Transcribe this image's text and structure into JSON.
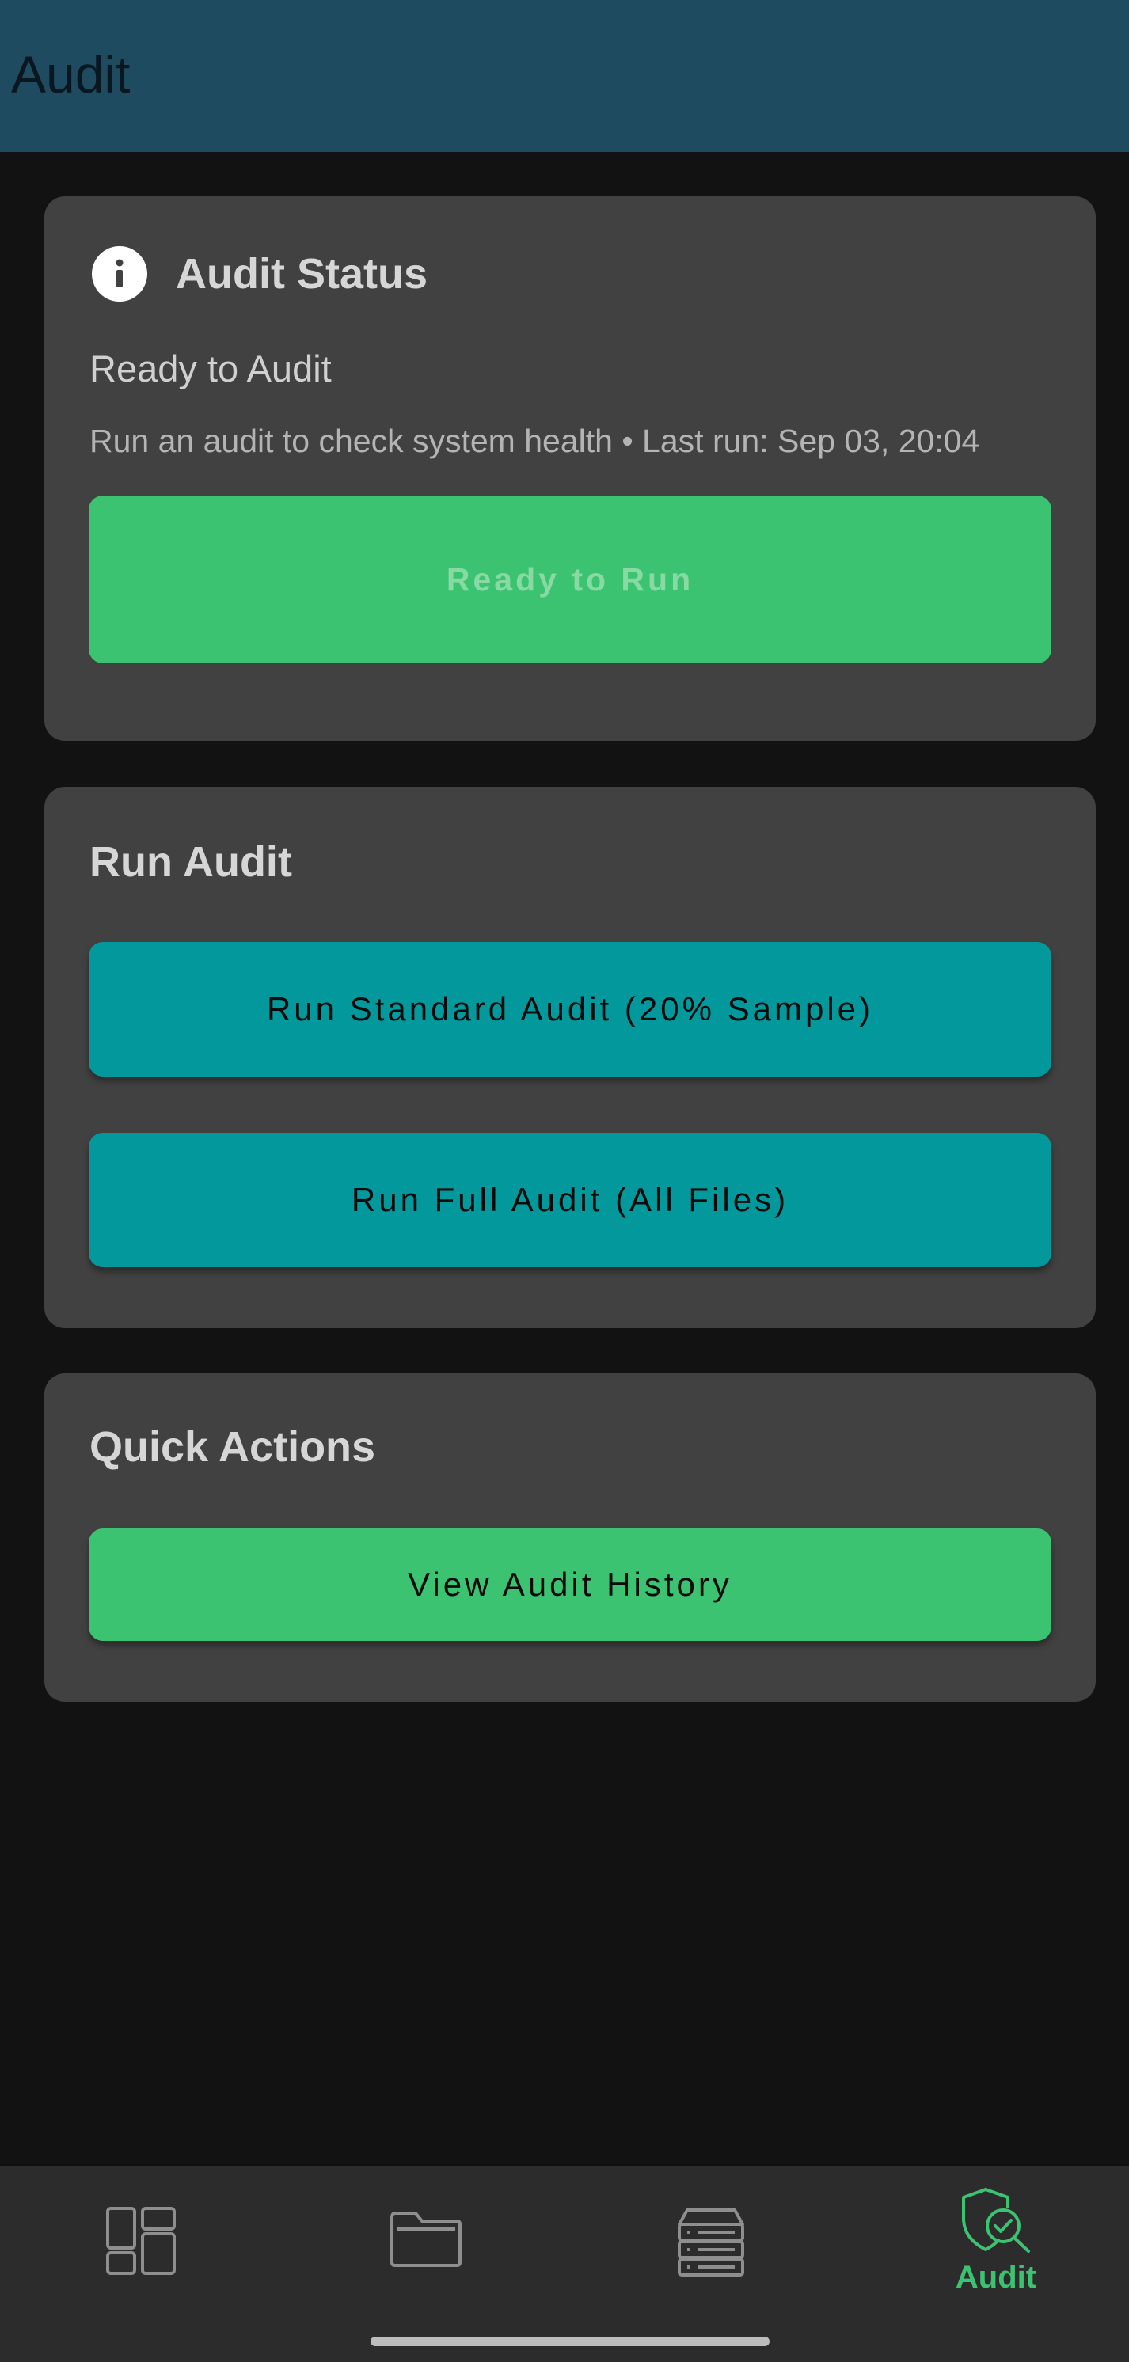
{
  "appbar": {
    "title": "Audit"
  },
  "status_card": {
    "icon": "info-icon",
    "title": "Audit Status",
    "subtitle": "Ready to Audit",
    "description": "Run an audit to check system health • Last run: Sep 03, 20:04",
    "button_label": "Ready to Run"
  },
  "run_card": {
    "title": "Run Audit",
    "standard_label": "Run Standard Audit (20% Sample)",
    "full_label": "Run Full Audit (All Files)"
  },
  "quick_card": {
    "title": "Quick Actions",
    "history_label": "View Audit History"
  },
  "bottom_nav": {
    "items": [
      {
        "icon": "dashboard-icon",
        "label": ""
      },
      {
        "icon": "folder-icon",
        "label": ""
      },
      {
        "icon": "storage-icon",
        "label": ""
      },
      {
        "icon": "audit-shield-icon",
        "label": "Audit",
        "active": true
      }
    ]
  },
  "colors": {
    "appbar": "#1f4b60",
    "background": "#121212",
    "card": "#414141",
    "green": "#3cc371",
    "teal": "#03989b",
    "nav_background": "#2c2c2c"
  }
}
